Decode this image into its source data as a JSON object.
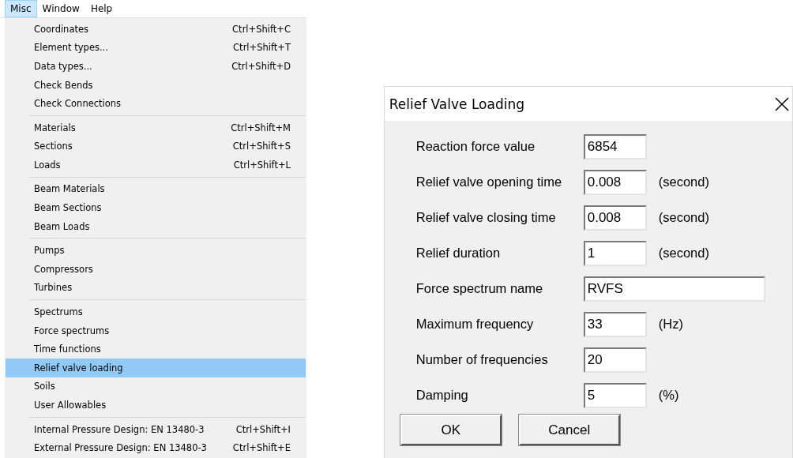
{
  "menubar": [
    {
      "label": "Misc",
      "selected": true
    },
    {
      "label": "Window",
      "selected": false
    },
    {
      "label": "Help",
      "selected": false
    }
  ],
  "menu": {
    "groups": [
      [
        {
          "label": "Coordinates",
          "shortcut": "Ctrl+Shift+C",
          "selected": false
        },
        {
          "label": "Element types...",
          "shortcut": "Ctrl+Shift+T",
          "selected": false
        },
        {
          "label": "Data types...",
          "shortcut": "Ctrl+Shift+D",
          "selected": false
        },
        {
          "label": "Check Bends",
          "selected": false
        },
        {
          "label": "Check Connections",
          "selected": false
        }
      ],
      [
        {
          "label": "Materials",
          "shortcut": "Ctrl+Shift+M",
          "selected": false
        },
        {
          "label": "Sections",
          "shortcut": "Ctrl+Shift+S",
          "selected": false
        },
        {
          "label": "Loads",
          "shortcut": "Ctrl+Shift+L",
          "selected": false
        }
      ],
      [
        {
          "label": "Beam Materials",
          "selected": false
        },
        {
          "label": "Beam Sections",
          "selected": false
        },
        {
          "label": "Beam Loads",
          "selected": false
        }
      ],
      [
        {
          "label": "Pumps",
          "selected": false
        },
        {
          "label": "Compressors",
          "selected": false
        },
        {
          "label": "Turbines",
          "selected": false
        }
      ],
      [
        {
          "label": "Spectrums",
          "selected": false
        },
        {
          "label": "Force spectrums",
          "selected": false
        },
        {
          "label": "Time functions",
          "selected": false
        },
        {
          "label": "Relief valve loading",
          "selected": true
        },
        {
          "label": "Soils",
          "selected": false
        },
        {
          "label": "User Allowables",
          "selected": false
        }
      ],
      [
        {
          "label": "Internal Pressure Design: EN 13480-3",
          "shortcut": "Ctrl+Shift+I",
          "selected": false
        },
        {
          "label": "External Pressure Design: EN 13480-3",
          "shortcut": "Ctrl+Shift+E",
          "selected": false
        }
      ]
    ]
  },
  "dialog": {
    "title": "Relief Valve Loading",
    "fields": [
      {
        "label": "Reaction force value",
        "value": "6854",
        "kind": "short"
      },
      {
        "label": "Relief valve opening time",
        "value": "0.008",
        "unit": "(second)",
        "kind": "short"
      },
      {
        "label": "Relief valve closing time",
        "value": "0.008",
        "unit": "(second)",
        "kind": "short"
      },
      {
        "label": "Relief duration",
        "value": "1",
        "unit": "(second)",
        "kind": "short"
      },
      {
        "label": "Force spectrum name",
        "value": "RVFS",
        "kind": "wide"
      },
      {
        "label": "Maximum frequency",
        "value": "33",
        "unit": "(Hz)",
        "kind": "short"
      },
      {
        "label": "Number of frequencies",
        "value": "20",
        "kind": "short"
      },
      {
        "label": "Damping",
        "value": "5",
        "unit": "(%)",
        "kind": "short"
      }
    ],
    "buttons": [
      "OK",
      "Cancel"
    ]
  }
}
